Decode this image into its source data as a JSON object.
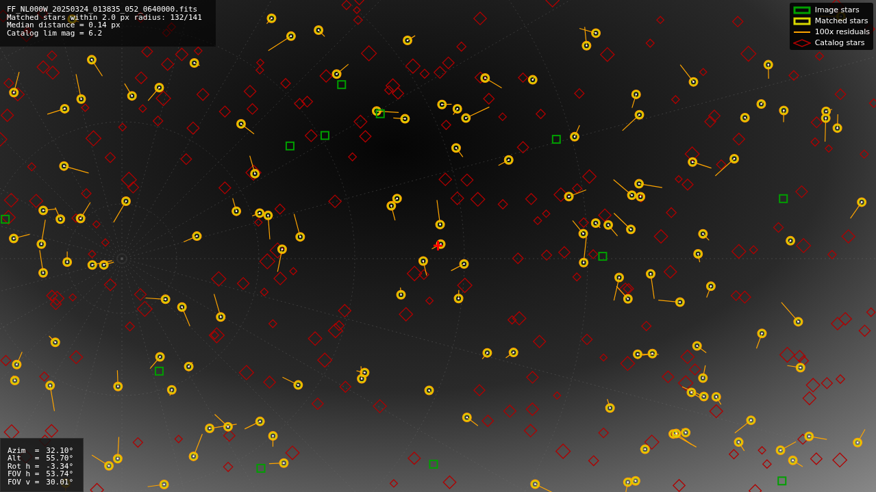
{
  "file_info": [
    "FF_NL000W_20250324_013835_052_0640000.fits",
    "Matched stars within 2.0 px radius: 132/141",
    "Median distance = 0.14 px",
    "Catalog lim mag = 6.2"
  ],
  "legend": [
    {
      "kind": "image",
      "label": "Image stars",
      "color": "#00a000"
    },
    {
      "kind": "matched",
      "label": "Matched stars",
      "color": "#d8d800"
    },
    {
      "kind": "residual",
      "label": "100x residuals",
      "color": "#ffa500"
    },
    {
      "kind": "catalog",
      "label": "Catalog stars",
      "color": "#b00000"
    }
  ],
  "pointing": [
    {
      "label": "Azim  =",
      "value": "32.10°"
    },
    {
      "label": "Alt   =",
      "value": "55.70°"
    },
    {
      "label": "Rot h =",
      "value": "-3.34°"
    },
    {
      "label": "FOV h =",
      "value": "53.74°"
    },
    {
      "label": "FOV v =",
      "value": "30.01°"
    }
  ]
}
